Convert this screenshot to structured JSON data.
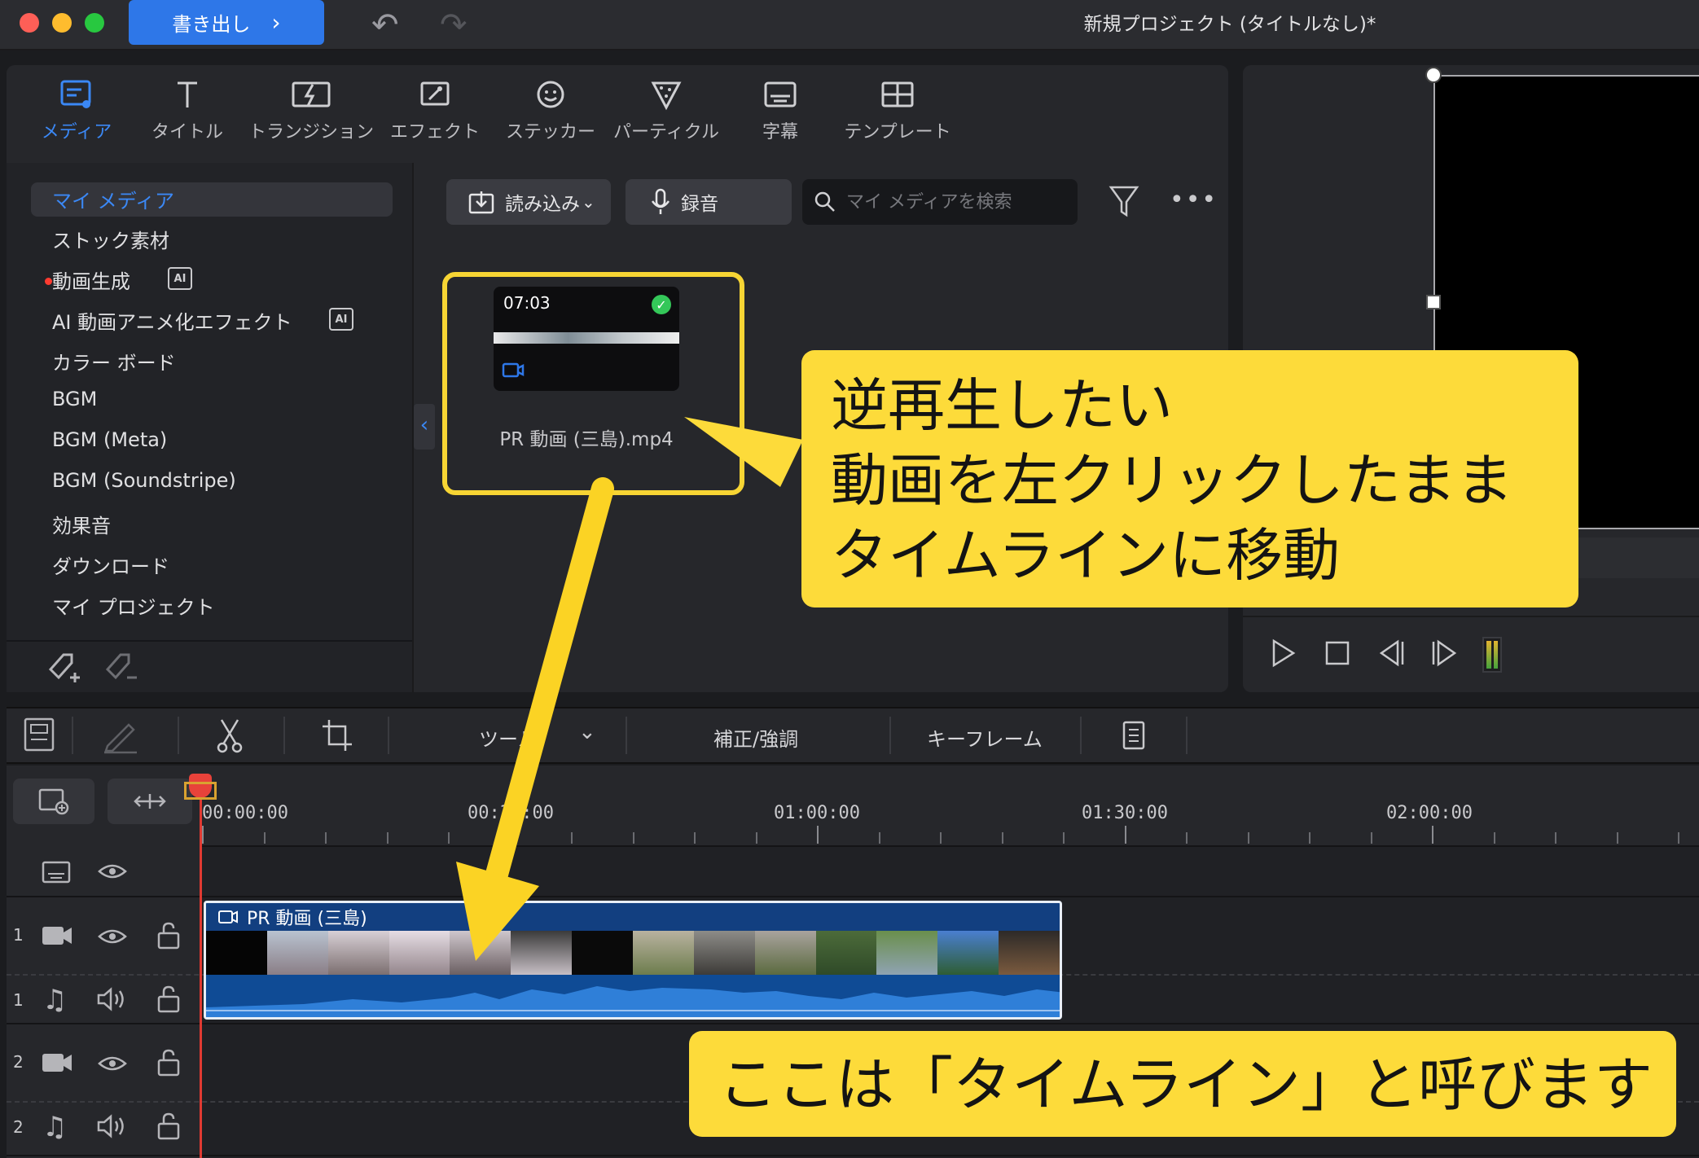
{
  "window": {
    "title": "新規プロジェクト (タイトルなし)*",
    "export_label": "書き出し"
  },
  "tabs": [
    {
      "label": "メディア",
      "icon": "media-icon",
      "active": true
    },
    {
      "label": "タイトル",
      "icon": "title-icon"
    },
    {
      "label": "トランジション",
      "icon": "transition-icon"
    },
    {
      "label": "エフェクト",
      "icon": "effect-icon"
    },
    {
      "label": "ステッカー",
      "icon": "sticker-icon"
    },
    {
      "label": "パーティクル",
      "icon": "particle-icon"
    },
    {
      "label": "字幕",
      "icon": "subtitle-icon"
    },
    {
      "label": "テンプレート",
      "icon": "template-icon"
    }
  ],
  "sidebar": {
    "items": [
      {
        "label": "マイ メディア",
        "active": true
      },
      {
        "label": "ストック素材"
      },
      {
        "label": "動画生成",
        "ai_badge": "AI",
        "new_dot": true
      },
      {
        "label": "AI 動画アニメ化エフェクト",
        "ai_badge": "AI"
      },
      {
        "label": "カラー ボード"
      },
      {
        "label": "BGM"
      },
      {
        "label": "BGM (Meta)"
      },
      {
        "label": "BGM (Soundstripe)"
      },
      {
        "label": "効果音"
      },
      {
        "label": "ダウンロード"
      },
      {
        "label": "マイ プロジェクト"
      }
    ]
  },
  "media_toolbar": {
    "import_label": "読み込み",
    "record_label": "録音",
    "search_placeholder": "マイ メディアを検索"
  },
  "media_clip": {
    "duration": "07:03",
    "name": "PR 動画 (三島).mp4",
    "status": "imported"
  },
  "timeline_toolbar": {
    "tools_label": "ツール",
    "correction_label": "補正/強調",
    "keyframe_label": "キーフレーム"
  },
  "timeline": {
    "ruler_labels": [
      "00:00:00",
      "00:30:00",
      "01:00:00",
      "01:30:00",
      "02:00:00"
    ],
    "tracks": [
      {
        "num": "1",
        "type": "video"
      },
      {
        "num": "1",
        "type": "audio"
      },
      {
        "num": "2",
        "type": "video"
      },
      {
        "num": "2",
        "type": "audio"
      }
    ],
    "clip_title": "PR 動画 (三島)"
  },
  "callouts": {
    "drag": {
      "line1": "逆再生したい",
      "line2": "動画を左クリックしたまま",
      "line3": "タイムラインに移動"
    },
    "timeline": "ここは「タイムライン」と呼びます"
  },
  "colors": {
    "accent": "#2e77e8",
    "active_tab": "#3b88f5",
    "callout_bg": "#fddb3a",
    "highlight": "#f7d534",
    "playhead": "#e03a32"
  }
}
